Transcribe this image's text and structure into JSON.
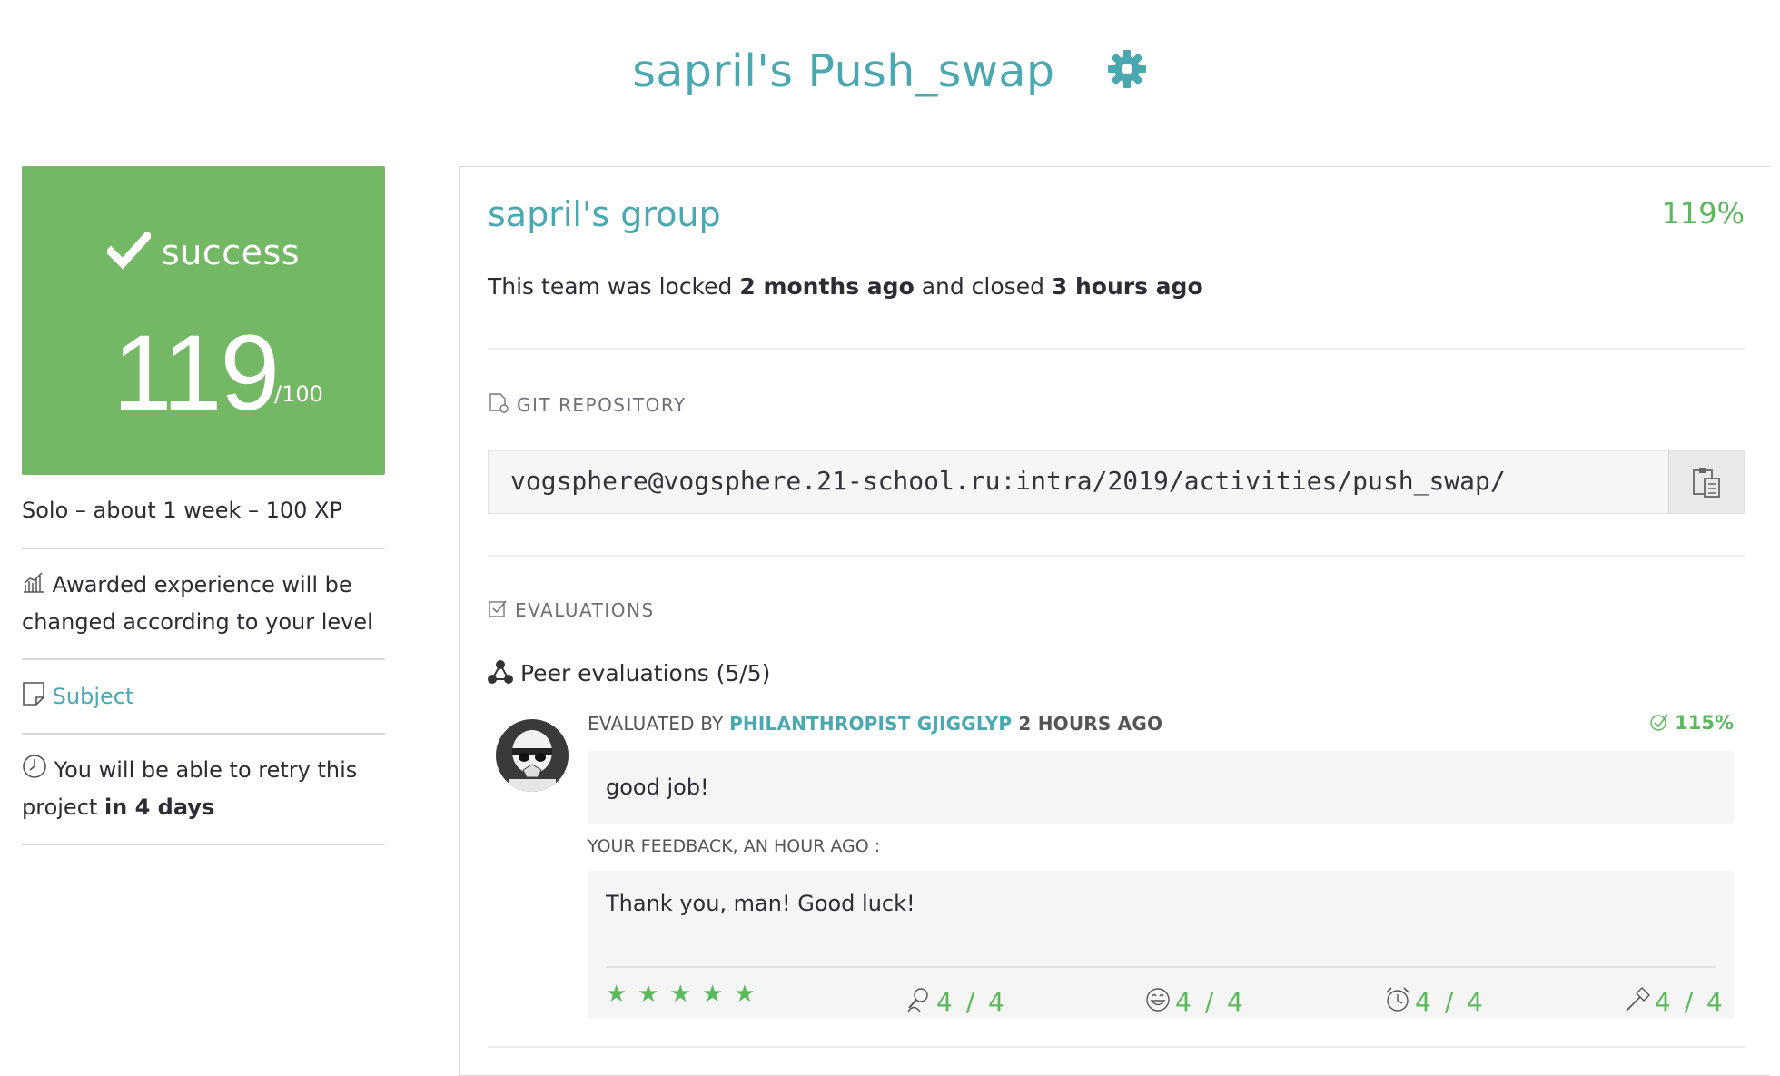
{
  "page": {
    "title": "sapril's Push_swap",
    "gear_icon": "gear-icon"
  },
  "score": {
    "status": "success",
    "value": "119",
    "max": "/100",
    "color": "#74b866"
  },
  "sidebar": {
    "meta": "Solo – about 1 week – 100 XP",
    "experience_note": "Awarded experience will be changed according to your level",
    "subject_link": "Subject",
    "retry_prefix": "You will be able to retry this project ",
    "retry_when": "in 4 days"
  },
  "group": {
    "title": "sapril's group",
    "percent": "119%",
    "status_1": "This team was locked ",
    "locked_when": "2 months ago",
    "status_2": " and closed ",
    "closed_when": "3 hours ago"
  },
  "git": {
    "label": "GIT REPOSITORY",
    "url": "vogsphere@vogsphere.21-school.ru:intra/2019/activities/push_swap/"
  },
  "evaluations": {
    "label": "EVALUATIONS",
    "peer_title": "Peer evaluations (5/5)",
    "items": [
      {
        "evaluated_by_label": "EVALUATED BY ",
        "evaluator": "PHILANTHROPIST GJIGGLYP",
        "when": " 2 HOURS AGO",
        "score": "115%",
        "comment": "good job!",
        "feedback_label": "YOUR FEEDBACK, AN HOUR AGO :",
        "feedback": "Thank you, man! Good luck!",
        "stars": "★★★★★",
        "metrics": [
          {
            "icon": "interested-icon",
            "value": "4 / 4"
          },
          {
            "icon": "nice-smiley-icon",
            "value": "4 / 4"
          },
          {
            "icon": "punctuality-clock-icon",
            "value": "4 / 4"
          },
          {
            "icon": "rigorous-hammer-icon",
            "value": "4 / 4"
          }
        ]
      }
    ]
  }
}
